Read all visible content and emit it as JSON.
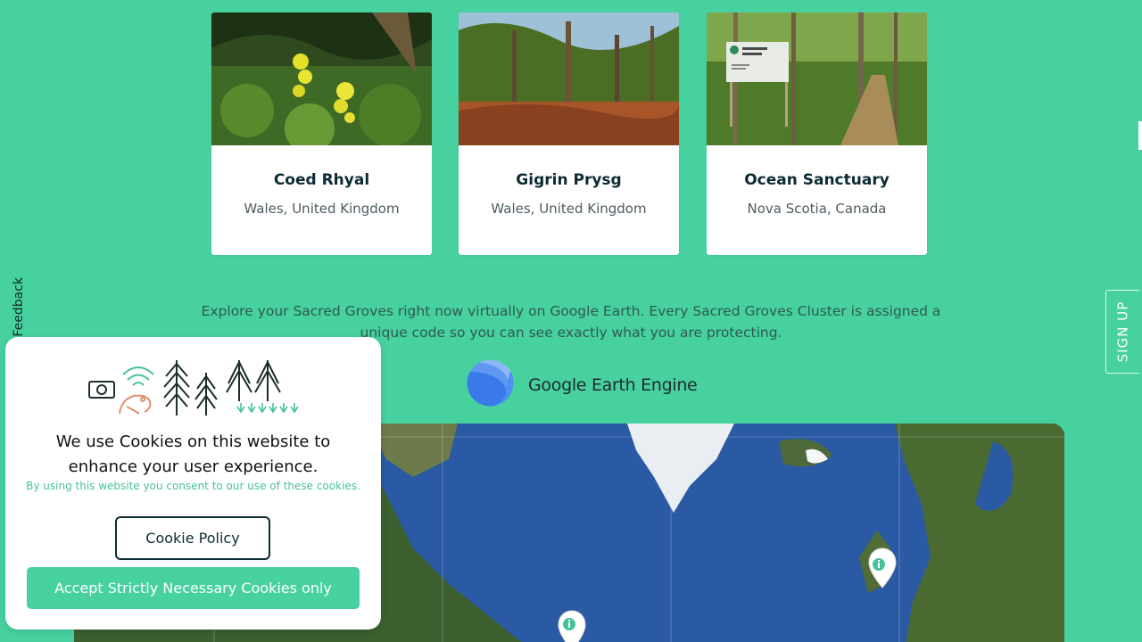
{
  "cards": [
    {
      "title": "Coed Rhyal",
      "location": "Wales, United Kingdom"
    },
    {
      "title": "Gigrin Prysg",
      "location": "Wales, United Kingdom"
    },
    {
      "title": "Ocean Sanctuary",
      "location": "Nova Scotia, Canada"
    }
  ],
  "explore_text": "Explore your Sacred Groves right now virtually on Google Earth. Every Sacred Groves Cluster is assigned a unique code so you can see exactly what you are protecting.",
  "google_earth": {
    "label": "Google Earth Engine"
  },
  "sidebar": {
    "signup": "SIGN UP",
    "feedback": "Feedback"
  },
  "cookie_banner": {
    "title": "We use Cookies on this website to enhance your user experience.",
    "subtitle": "By using this website you consent to our use of these cookies.",
    "policy_button": "Cookie Policy",
    "accept_button": "Accept Strictly Necessary Cookies only"
  },
  "colors": {
    "background": "#46d19f",
    "heading": "#0c2b33",
    "accent": "#46c29b"
  },
  "icons": [
    "info-pin-icon",
    "feedback-icon",
    "google-earth-logo-icon"
  ]
}
